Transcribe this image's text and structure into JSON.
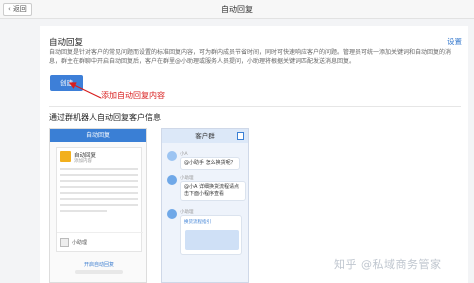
{
  "topbar": {
    "back_label": "返回",
    "title": "自动回复"
  },
  "card": {
    "title": "自动回复",
    "settings_label": "设置",
    "description": "自动回复是针对客户的常见问题而设置的标准回复内容，可为群内成员节省时间，同时可快速响应客户的问题。管理员可统一添加关键词和自动回复的消息，群主在群聊中开启自动回复后，客户在群里@小助理或服务人员提问，小助理将根据关键词匹配发送消息回复。",
    "create_button": "创建",
    "annotation": "添加自动回复内容",
    "section_title": "通过群机器人自动回复客户信息"
  },
  "preview_left": {
    "header": "自动回复",
    "item_name": "自动回复",
    "item_sub": "添加内容",
    "footer_name": "小助理",
    "link": "开启自动回复"
  },
  "preview_right": {
    "header": "客户群",
    "msg1_tag": "小A",
    "msg1": "@小助手 怎么换货呢？",
    "msg2_tag": "小助理",
    "msg2": "@小A 详细换货流程请点击下面小程序查看",
    "msg3_tag": "小助理",
    "img_title": "换货流程指引"
  },
  "watermark": "知乎 @私域商务管家",
  "colors": {
    "primary": "#3d7fd8",
    "annotation": "#d81e1e",
    "warning": "#f2b01e"
  }
}
